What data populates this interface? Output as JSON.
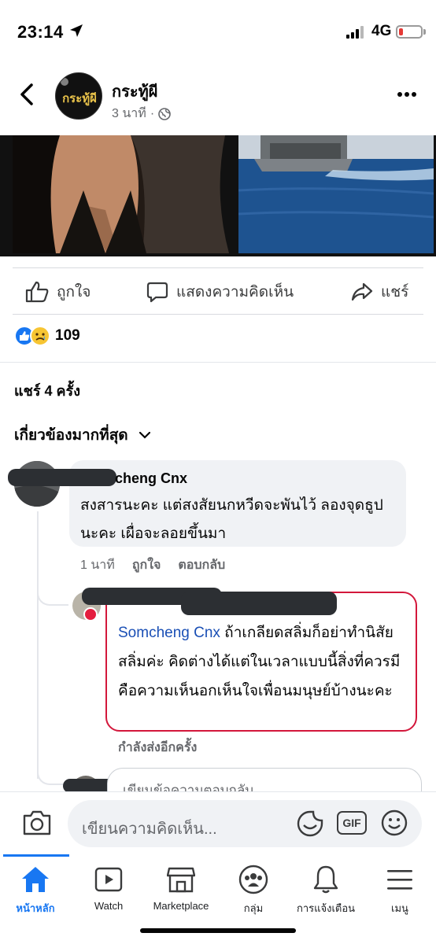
{
  "status_bar": {
    "time": "23:14",
    "network": "4G",
    "battery_color": "#e53935"
  },
  "header": {
    "page_name": "กระทู้ผี",
    "avatar_text": "กระทู้ผี",
    "time_ago": "3 นาที",
    "separator": "·",
    "privacy_icon": "globe-icon"
  },
  "actions": {
    "like": "ถูกใจ",
    "comment": "แสดงความคิดเห็น",
    "share": "แชร์"
  },
  "reactions": {
    "count": "109",
    "types": [
      "like",
      "sad"
    ]
  },
  "shares_text": "แชร์ 4 ครั้ง",
  "sort_label": "เกี่ยวข้องมากที่สุด",
  "comment": {
    "author_visible": "cheng Cnx",
    "text": "สงสารนะคะ แต่สงสัยนกหวีดจะพันไว้ ลองจุดธูปนะคะ เผื่อจะลอยขึ้นมา",
    "time": "1 นาที",
    "like_label": "ถูกใจ",
    "reply_label": "ตอบกลับ"
  },
  "reply": {
    "mention": "Somcheng Cnx",
    "text": " ถ้าเกลียดสลิ่มก็อย่าทำนิสัยสลิ่มค่ะ คิดต่างได้แต่ในเวลาแบบนี้สิ่งที่ควรมีคือความเห็นอกเห็นใจเพื่อนมนุษย์บ้างนะคะ",
    "status": "กำลังส่งอีกครั้ง",
    "border_color": "#d3173b"
  },
  "reply_input_placeholder": "เขียนข้อความตอบกลับ...",
  "composer": {
    "placeholder": "เขียนความคิดเห็น...",
    "gif_label": "GIF"
  },
  "tabs": [
    {
      "label": "หน้าหลัก",
      "icon": "home-icon",
      "active": true
    },
    {
      "label": "Watch",
      "icon": "watch-icon",
      "active": false
    },
    {
      "label": "Marketplace",
      "icon": "marketplace-icon",
      "active": false
    },
    {
      "label": "กลุ่ม",
      "icon": "groups-icon",
      "active": false
    },
    {
      "label": "การแจ้งเตือน",
      "icon": "bell-icon",
      "active": false
    },
    {
      "label": "เมนู",
      "icon": "menu-icon",
      "active": false
    }
  ],
  "colors": {
    "brand": "#1877f2",
    "mention": "#1a4fb5",
    "muted": "#65676b"
  }
}
